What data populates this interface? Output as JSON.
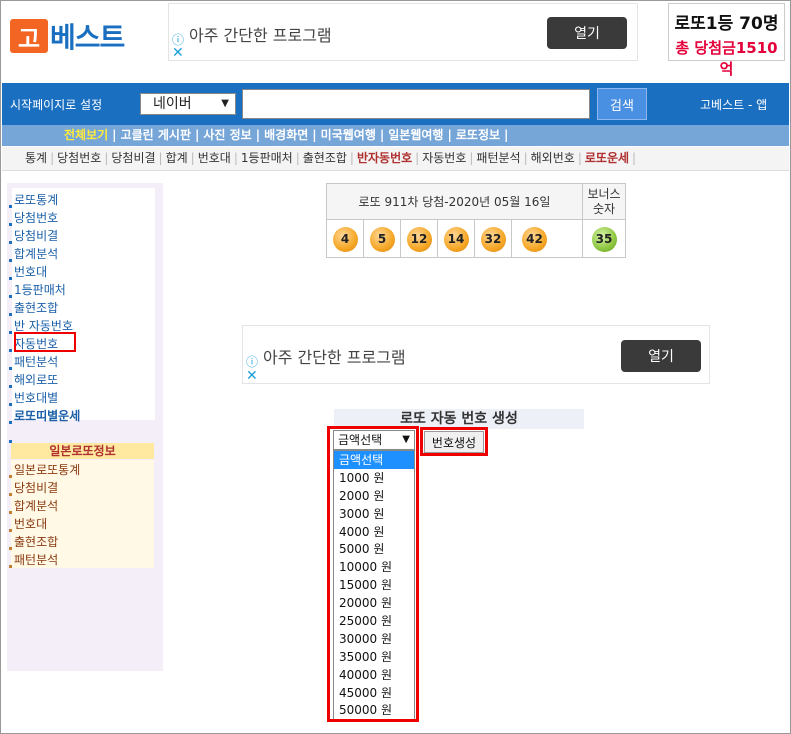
{
  "logo": {
    "mark": "고",
    "text": "베스트"
  },
  "ad_top": {
    "text": "아주 간단한 프로그램",
    "button": "열기"
  },
  "lotto_badge": {
    "line1": "로또1등 70명",
    "line2": "총 당첨금1510억"
  },
  "toolbar": {
    "set_start": "시작페이지로 설정",
    "engine_selected": "네이버",
    "search_button": "검색",
    "app_link": "고베스트 - 앱"
  },
  "menu1": [
    "전체보기",
    "고클린 게시판",
    "사진 정보",
    "배경화면",
    "미국웹여행",
    "일본웹여행",
    "로또정보"
  ],
  "menu2": [
    "통계",
    "당첨번호",
    "당첨비결",
    "합계",
    "번호대",
    "1등판매처",
    "출현조합",
    "반자동번호",
    "자동번호",
    "패턴분석",
    "해외번호",
    "로또운세"
  ],
  "sidebar": {
    "items": [
      "로또통계",
      "당첨번호",
      "당첨비결",
      "합계분석",
      "번호대",
      "1등판매처",
      "출현조합",
      "반 자동번호",
      "자동번호",
      "패턴분석",
      "해외로또",
      "번호대별",
      "로또띠별운세"
    ],
    "jp_header": "일본로또정보",
    "jp_items": [
      "일본로또통계",
      "당첨비결",
      "합계분석",
      "번호대",
      "출현조합",
      "패턴분석"
    ]
  },
  "result": {
    "header": "로또 911차 당첨-2020년 05월 16일",
    "bonus_label": "보너스 숫자",
    "numbers": [
      "4",
      "5",
      "12",
      "14",
      "32",
      "42"
    ],
    "bonus": "35"
  },
  "ad_mid": {
    "text": "아주 간단한 프로그램",
    "button": "열기"
  },
  "generator": {
    "title": "로또 자동 번호 생성",
    "select_value": "금액선택",
    "button": "번호생성",
    "options": [
      "금액선택",
      "1000 원",
      "2000 원",
      "3000 원",
      "4000 원",
      "5000 원",
      "10000 원",
      "15000 원",
      "20000 원",
      "25000 원",
      "30000 원",
      "35000 원",
      "40000 원",
      "45000 원",
      "50000 원"
    ]
  },
  "colors": {
    "brand_blue": "#1a6fc0",
    "logo_orange": "#f26522",
    "highlight_red": "#e00000",
    "ball_orange": "#f5a623",
    "ball_green": "#8dc63f"
  }
}
